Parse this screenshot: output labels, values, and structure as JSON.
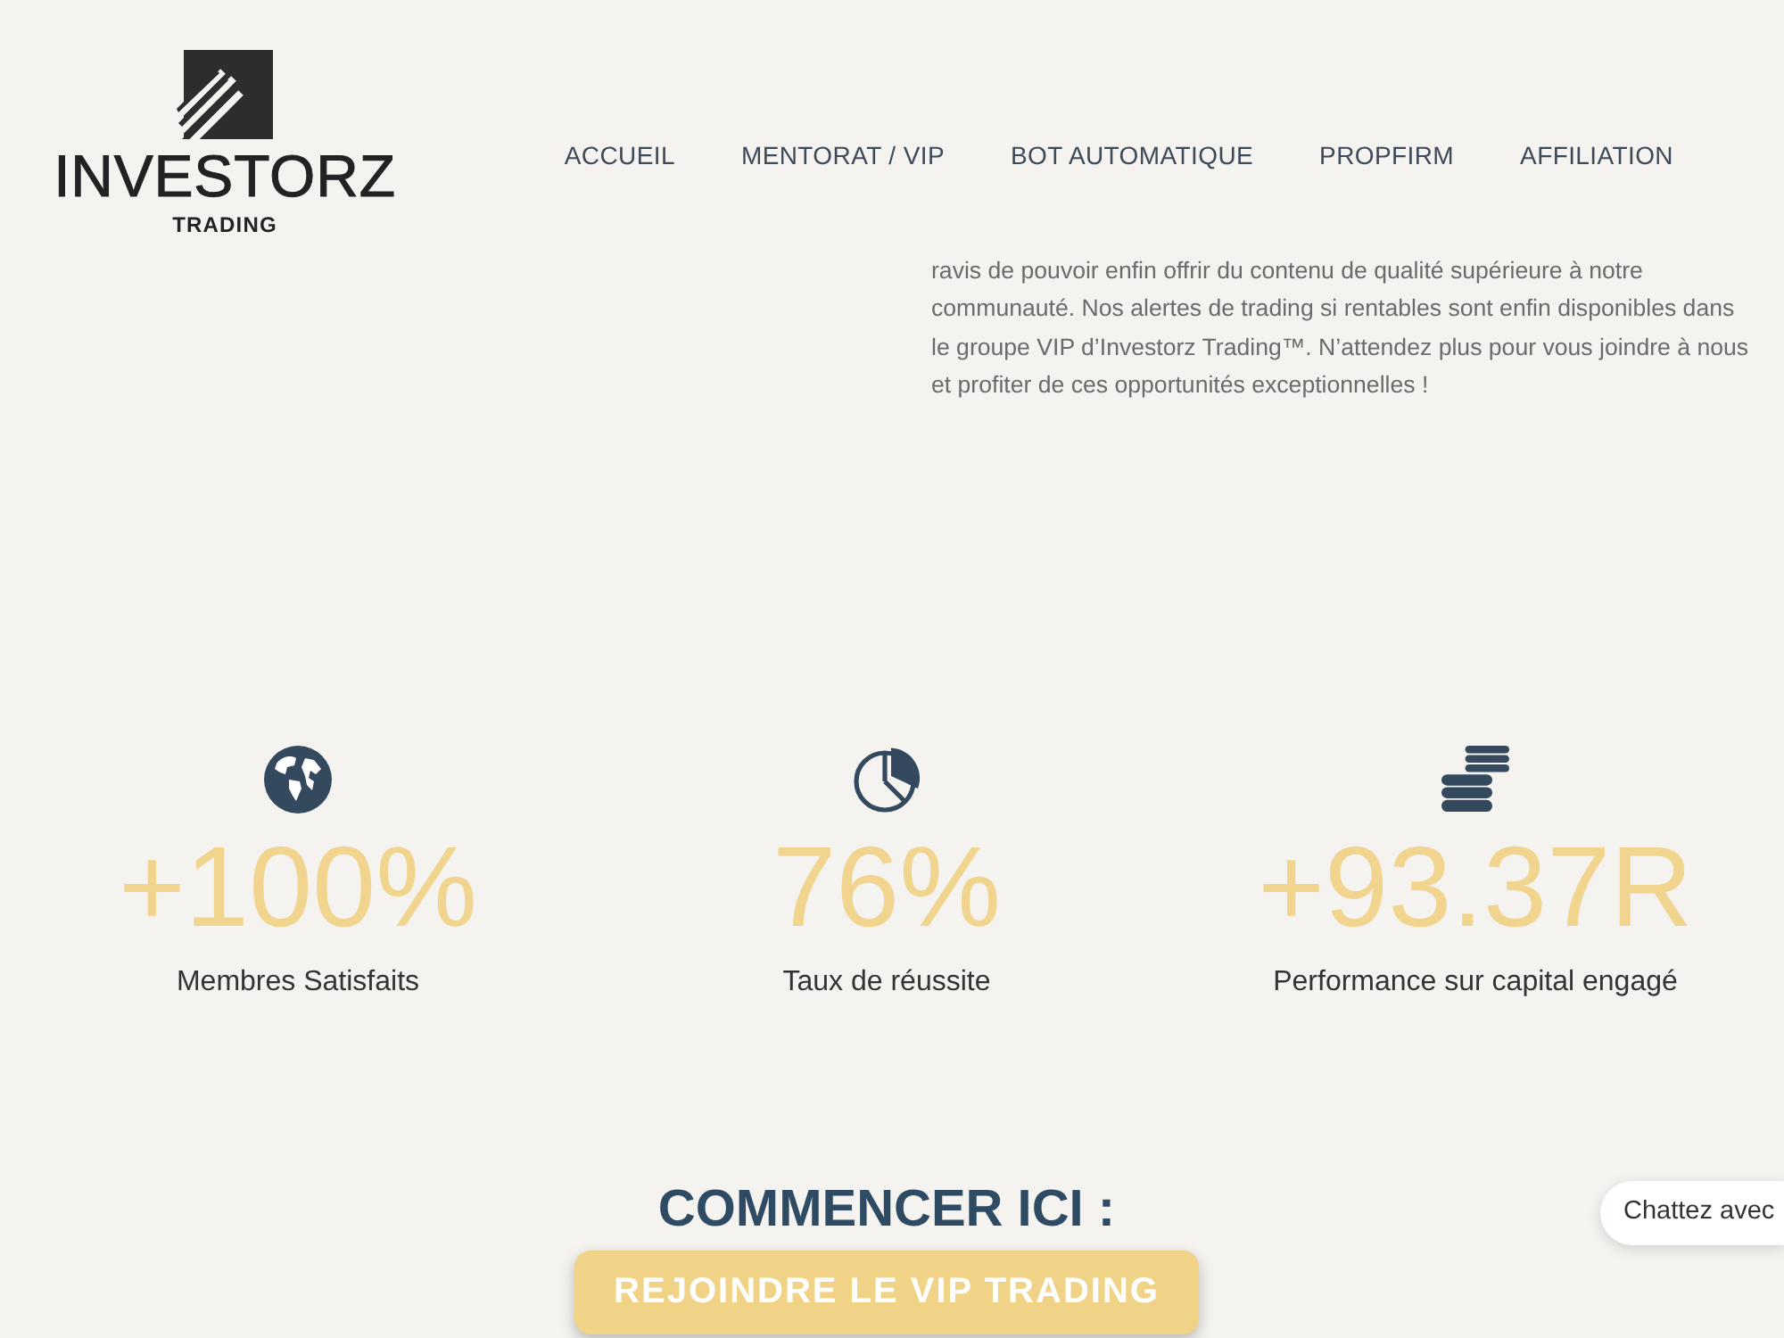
{
  "logo": {
    "name": "INVESTORZ",
    "tagline": "TRADING"
  },
  "nav": [
    "ACCUEIL",
    "MENTORAT / VIP",
    "BOT AUTOMATIQUE",
    "PROPFIRM",
    "AFFILIATION"
  ],
  "intro": {
    "text": "ravis de pouvoir enfin offrir du contenu de qualité supérieure à notre communauté. Nos alertes de trading si rentables sont enfin disponibles dans le groupe VIP d’Investorz Trading™. N’attendez plus pour vous joindre à nous et profiter de ces opportunités exceptionnelles !"
  },
  "stats": [
    {
      "kind": "globe",
      "value": "+100%",
      "label": "Membres Satisfaits"
    },
    {
      "kind": "pie",
      "value": "76%",
      "label": "Taux de réussite"
    },
    {
      "kind": "coins",
      "value": "+93.37R",
      "label": "Performance sur capital engagé"
    }
  ],
  "cta": {
    "heading": "COMMENCER ICI :",
    "button": "REJOINDRE LE VIP TRADING"
  },
  "chat": {
    "label": "Chattez avec"
  }
}
